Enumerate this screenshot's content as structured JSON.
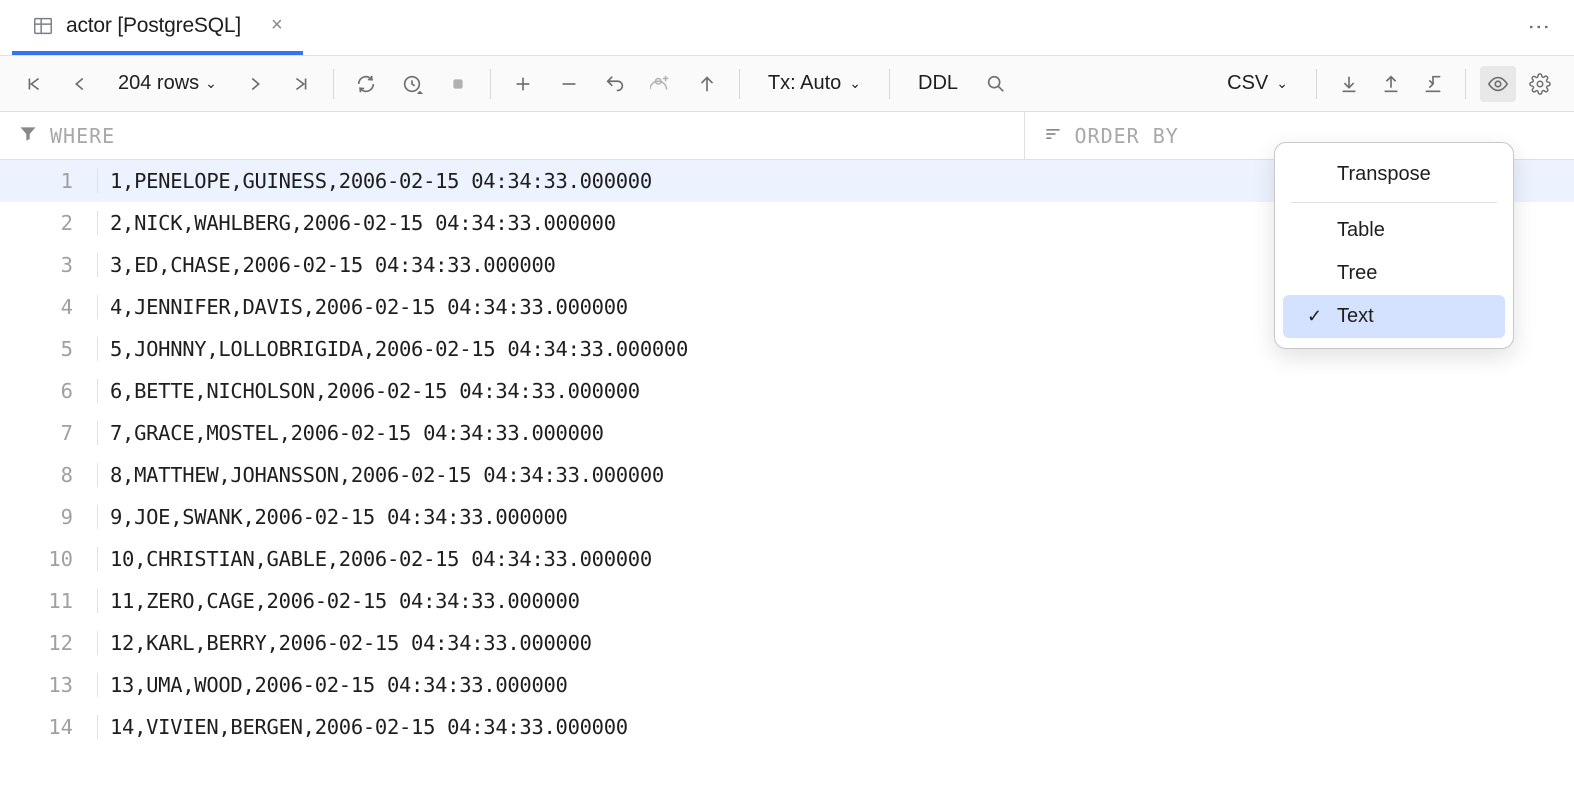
{
  "tab": {
    "title": "actor [PostgreSQL]"
  },
  "toolbar": {
    "rowcount": "204 rows",
    "tx_label": "Tx: Auto",
    "ddl_label": "DDL",
    "csv_label": "CSV"
  },
  "filter": {
    "where_label": "WHERE",
    "orderby_label": "ORDER BY"
  },
  "popup": {
    "transpose": "Transpose",
    "table": "Table",
    "tree": "Tree",
    "text": "Text"
  },
  "rows": [
    {
      "n": 1,
      "text": "1,PENELOPE,GUINESS,2006-02-15 04:34:33.000000",
      "selected": true
    },
    {
      "n": 2,
      "text": "2,NICK,WAHLBERG,2006-02-15 04:34:33.000000"
    },
    {
      "n": 3,
      "text": "3,ED,CHASE,2006-02-15 04:34:33.000000"
    },
    {
      "n": 4,
      "text": "4,JENNIFER,DAVIS,2006-02-15 04:34:33.000000"
    },
    {
      "n": 5,
      "text": "5,JOHNNY,LOLLOBRIGIDA,2006-02-15 04:34:33.000000"
    },
    {
      "n": 6,
      "text": "6,BETTE,NICHOLSON,2006-02-15 04:34:33.000000"
    },
    {
      "n": 7,
      "text": "7,GRACE,MOSTEL,2006-02-15 04:34:33.000000"
    },
    {
      "n": 8,
      "text": "8,MATTHEW,JOHANSSON,2006-02-15 04:34:33.000000"
    },
    {
      "n": 9,
      "text": "9,JOE,SWANK,2006-02-15 04:34:33.000000"
    },
    {
      "n": 10,
      "text": "10,CHRISTIAN,GABLE,2006-02-15 04:34:33.000000"
    },
    {
      "n": 11,
      "text": "11,ZERO,CAGE,2006-02-15 04:34:33.000000"
    },
    {
      "n": 12,
      "text": "12,KARL,BERRY,2006-02-15 04:34:33.000000"
    },
    {
      "n": 13,
      "text": "13,UMA,WOOD,2006-02-15 04:34:33.000000"
    },
    {
      "n": 14,
      "text": "14,VIVIEN,BERGEN,2006-02-15 04:34:33.000000"
    }
  ]
}
